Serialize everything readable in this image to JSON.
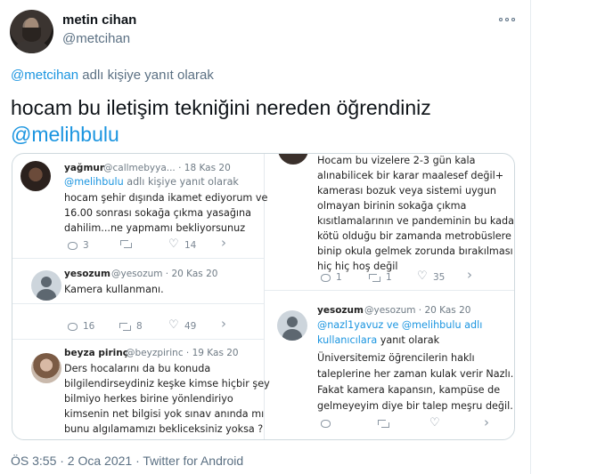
{
  "author": {
    "name": "metin cihan",
    "handle": "@metcihan"
  },
  "more_icon": "more-horizontal-icon",
  "reply_to": {
    "handle": "@metcihan",
    "suffix": " adlı kişiye yanıt olarak"
  },
  "tweet": {
    "text": "hocam bu iletişim tekniğini nereden öğrendiniz",
    "mention": "@melihbulu"
  },
  "screenshot": {
    "left": {
      "yagmur": {
        "name": "yağmur",
        "meta": "@callmebyya... · 18 Kas 20",
        "reply_handle": "@melihbulu",
        "reply_suffix": " adlı kişiye yanıt olarak",
        "lines": [
          "hocam şehir dışında ikamet ediyorum ve",
          "16.00 sonrası sokağa çıkma yasağına",
          "dahilim...ne yapmamı bekliyorsunuz"
        ],
        "replies": "3",
        "likes": "14"
      },
      "yesozum": {
        "name": "yesozum",
        "meta": "@yesozum · 20 Kas 20",
        "text": "Kamera kullanmanı.",
        "replies": "16",
        "retweets": "8",
        "likes": "49"
      },
      "beyza": {
        "name": "beyza pirinç",
        "meta": "@beyzpirinc · 19 Kas 20",
        "lines": [
          "Ders hocalarını da bu konuda",
          "bilgilendirseydiniz keşke kimse hiçbir şey",
          "bilmiyo herkes birine yönlendiriyo",
          "kimsenin net bilgisi yok sınav anında mı",
          "bunu algılamamızı bekliceksiniz yoksa ?"
        ]
      }
    },
    "right": {
      "top": {
        "lines": [
          "Hocam bu vizelere 2-3 gün kala",
          "alınabilicek bir karar maalesef değil+",
          "kamerası bozuk veya sistemi uygun",
          "olmayan birinin sokağa çıkma",
          "kısıtlamalarının ve pandeminin bu kadar",
          "kötü olduğu bir zamanda metrobüslere",
          "binip okula gelmek zorunda bırakılması",
          "hiç hiç hoş değil"
        ],
        "replies": "1",
        "retweets": "1",
        "likes": "35"
      },
      "yesozum": {
        "name": "yesozum",
        "meta": "@yesozum · 20 Kas 20",
        "reply_line1": "@nazl1yavuz ve @melihbulu adlı",
        "reply_line2_link": "kullanıcılara",
        "reply_line2_suffix": " yanıt olarak",
        "lines": [
          "Üniversitemiz öğrencilerin haklı",
          "taleplerine her zaman kulak verir Nazlı.",
          "Fakat kamera kapansın, kampüse de",
          "gelmeyeyim diye bir talep meşru değil."
        ]
      }
    }
  },
  "footer": "ÖS 3:55 · 2 Oca 2021 · Twitter for Android"
}
